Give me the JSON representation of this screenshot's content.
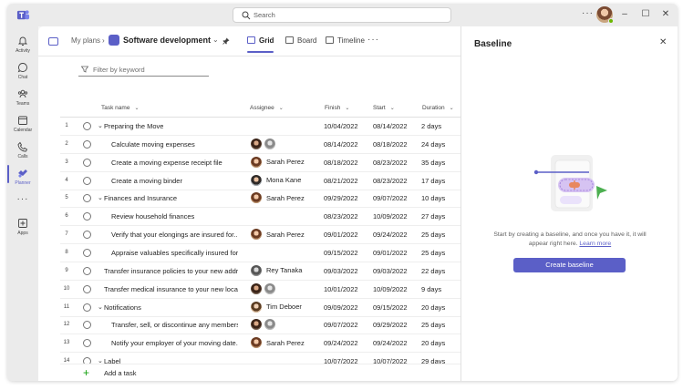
{
  "titlebar": {
    "search_placeholder": "Search",
    "more_label": "···",
    "minimize": "–",
    "maximize": "☐",
    "close": "✕"
  },
  "rail": {
    "items": [
      {
        "label": "Activity",
        "icon": "bell-icon"
      },
      {
        "label": "Chat",
        "icon": "chat-icon"
      },
      {
        "label": "Teams",
        "icon": "teams-icon"
      },
      {
        "label": "Calendar",
        "icon": "calendar-icon"
      },
      {
        "label": "Calls",
        "icon": "phone-icon"
      },
      {
        "label": "Planner",
        "icon": "planner-icon",
        "active": true
      },
      {
        "label": "Apps",
        "icon": "apps-icon"
      }
    ],
    "more_label": "···"
  },
  "header": {
    "breadcrumb_root": "My plans",
    "breadcrumb_sep": "›",
    "plan_title": "Software development",
    "caret": "⌄",
    "views": [
      "Grid",
      "Board",
      "Timeline"
    ],
    "active_view": "Grid",
    "more_label": "···"
  },
  "filter": {
    "placeholder": "Filter by keyword"
  },
  "columns": {
    "task": "Task name",
    "assignee": "Assignee",
    "finish": "Finish",
    "start": "Start",
    "duration": "Duration",
    "sort_caret": "⌄"
  },
  "rows": [
    {
      "num": "1",
      "task": "Preparing the Move",
      "group": true,
      "assignees": [],
      "name": "",
      "finish": "10/04/2022",
      "start": "08/14/2022",
      "duration": "2 days"
    },
    {
      "num": "2",
      "task": "Calculate moving expenses",
      "group": false,
      "assignees": [
        "f3",
        "g2"
      ],
      "name": "",
      "finish": "08/14/2022",
      "start": "08/18/2022",
      "duration": "24 days"
    },
    {
      "num": "3",
      "task": "Create a moving expense receipt file",
      "group": false,
      "assignees": [
        "f1"
      ],
      "name": "Sarah Perez",
      "finish": "08/18/2022",
      "start": "08/23/2022",
      "duration": "35 days"
    },
    {
      "num": "4",
      "task": "Create a moving binder",
      "group": false,
      "assignees": [
        "f2"
      ],
      "name": "Mona Kane",
      "finish": "08/21/2022",
      "start": "08/23/2022",
      "duration": "17 days"
    },
    {
      "num": "5",
      "task": "Finances and Insurance",
      "group": true,
      "assignees": [
        "f1"
      ],
      "name": "Sarah Perez",
      "finish": "09/29/2022",
      "start": "09/07/2022",
      "duration": "10 days"
    },
    {
      "num": "6",
      "task": "Review household finances",
      "group": false,
      "assignees": [],
      "name": "",
      "finish": "08/23/2022",
      "start": "10/09/2022",
      "duration": "27 days"
    },
    {
      "num": "7",
      "task": "Verify that your elongings are insured for...",
      "group": false,
      "assignees": [
        "f1"
      ],
      "name": "Sarah Perez",
      "finish": "09/01/2022",
      "start": "09/24/2022",
      "duration": "25 days"
    },
    {
      "num": "8",
      "task": "Appraise valuables specifically insured for...",
      "group": false,
      "assignees": [],
      "name": "",
      "finish": "09/15/2022",
      "start": "09/01/2022",
      "duration": "25 days"
    },
    {
      "num": "9",
      "task": "Transfer insurance policies to your new addr...",
      "group": false,
      "assignees": [
        "g1"
      ],
      "name": "Rey Tanaka",
      "finish": "09/03/2022",
      "start": "09/03/2022",
      "duration": "22 days"
    },
    {
      "num": "10",
      "task": "Transfer medical insurance to your new locati...",
      "group": false,
      "assignees": [
        "f3",
        "g2"
      ],
      "name": "",
      "finish": "10/01/2022",
      "start": "10/09/2022",
      "duration": "9 days"
    },
    {
      "num": "11",
      "task": "Notifications",
      "group": true,
      "assignees": [
        "f4"
      ],
      "name": "Tim Deboer",
      "finish": "09/09/2022",
      "start": "09/15/2022",
      "duration": "20 days"
    },
    {
      "num": "12",
      "task": "Transfer, sell, or discontinue any members...",
      "group": false,
      "assignees": [
        "f3",
        "g2"
      ],
      "name": "",
      "finish": "09/07/2022",
      "start": "09/29/2022",
      "duration": "25 days"
    },
    {
      "num": "13",
      "task": "Notify your employer of your moving date...",
      "group": false,
      "assignees": [
        "f1"
      ],
      "name": "Sarah Perez",
      "finish": "09/24/2022",
      "start": "09/24/2022",
      "duration": "20 days"
    },
    {
      "num": "14",
      "task": "Label",
      "group": true,
      "assignees": [],
      "name": "",
      "finish": "10/07/2022",
      "start": "10/07/2022",
      "duration": "29 days"
    }
  ],
  "add_task": {
    "plus": "+",
    "label": "Add a task"
  },
  "panel": {
    "title": "Baseline",
    "close": "✕",
    "message": "Start by creating a baseline, and once you have it, it will appear right here.",
    "link": "Learn more",
    "button": "Create baseline"
  },
  "colors": {
    "accent": "#5b5fc7",
    "add_plus": "#13a10e"
  }
}
